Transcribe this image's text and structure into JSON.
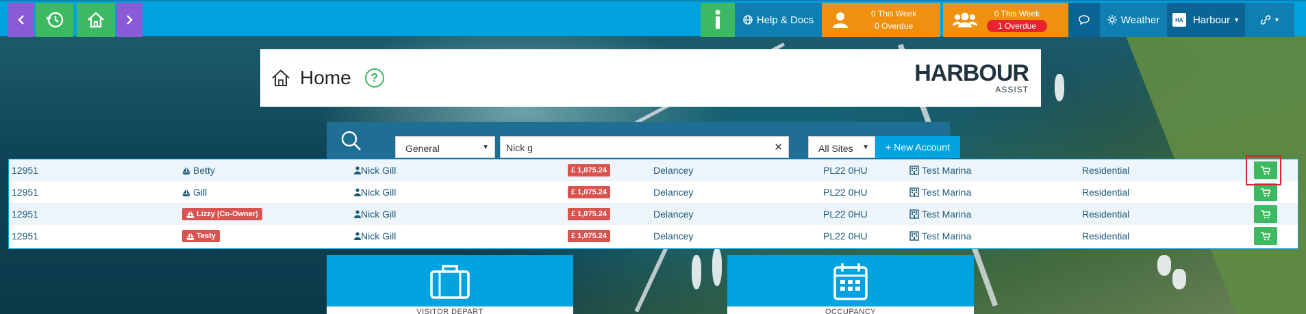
{
  "topbar": {
    "help_docs": "Help & Docs",
    "individual_this_week": "0 This Week",
    "individual_overdue": "0 Overdue",
    "group_this_week": "0 This Week",
    "group_overdue": "1 Overdue",
    "weather": "Weather",
    "harbour": "Harbour",
    "harbour_badge": "HA"
  },
  "page": {
    "title": "Home",
    "help_symbol": "?",
    "logo_main": "HARBOUR",
    "logo_sub": "ASSIST"
  },
  "search": {
    "category": "General",
    "query": "Nick g",
    "sites": "All Sites",
    "new_account": "+ New Account"
  },
  "results": [
    {
      "id": "12951",
      "boat": "Betty",
      "boat_tagged": false,
      "owner": "Nick Gill",
      "balance": "£ 1,075.24",
      "address": "Delancey",
      "postcode": "PL22 0HU",
      "site": "Test Marina",
      "type": "Residential"
    },
    {
      "id": "12951",
      "boat": "Gill",
      "boat_tagged": false,
      "owner": "Nick Gill",
      "balance": "£ 1,075.24",
      "address": "Delancey",
      "postcode": "PL22 0HU",
      "site": "Test Marina",
      "type": "Residential"
    },
    {
      "id": "12951",
      "boat": "Lizzy (Co-Owner)",
      "boat_tagged": true,
      "owner": "Nick Gill",
      "balance": "£ 1,075.24",
      "address": "Delancey",
      "postcode": "PL22 0HU",
      "site": "Test Marina",
      "type": "Residential"
    },
    {
      "id": "12951",
      "boat": "Testy",
      "boat_tagged": true,
      "owner": "Nick Gill",
      "balance": "£ 1,075.24",
      "address": "Delancey",
      "postcode": "PL22 0HU",
      "site": "Test Marina",
      "type": "Residential"
    }
  ],
  "tiles": [
    {
      "label": "VISITOR DEPART",
      "icon": "briefcase-icon"
    },
    {
      "label": "OCCUPANCY",
      "icon": "calendar-icon"
    }
  ],
  "colors": {
    "topbar": "#00a2e0",
    "purple": "#8a5bd6",
    "green": "#3dba61",
    "orange": "#f0900f",
    "danger": "#d9534f"
  }
}
